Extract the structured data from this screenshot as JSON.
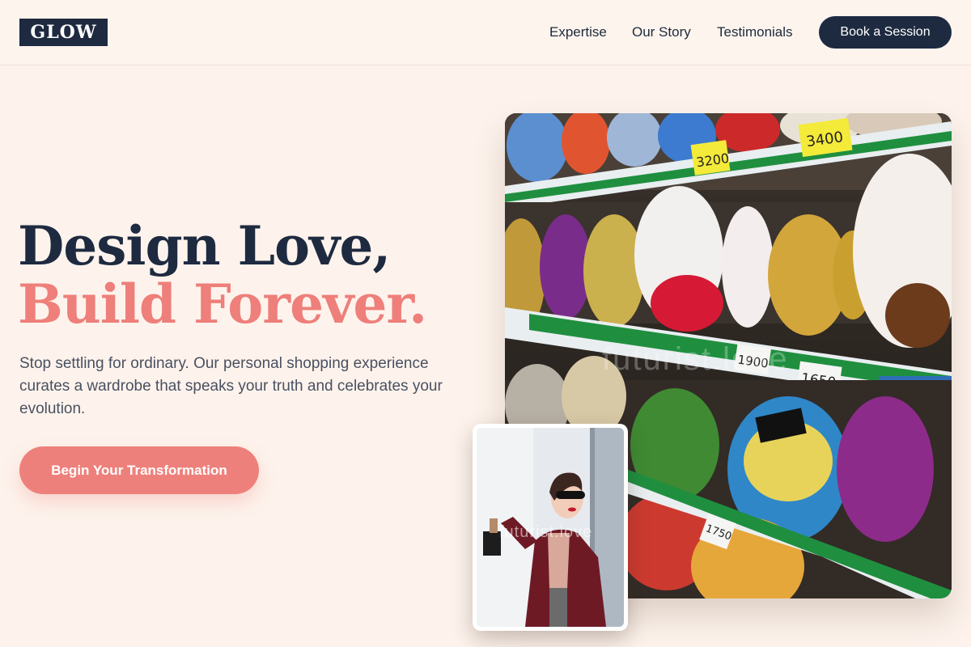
{
  "header": {
    "logo": "GLOW",
    "nav": [
      "Expertise",
      "Our Story",
      "Testimonials"
    ],
    "cta": "Book a Session"
  },
  "hero": {
    "title_line_1": "Design Love,",
    "title_line_2": "Build Forever.",
    "subtitle": "Stop settling for ordinary. Our personal shopping experience curates a wardrobe that speaks your truth and celebrates your evolution.",
    "cta": "Begin Your Transformation"
  },
  "images": {
    "main_watermark": "futurist.love",
    "inset_watermark": "futurist.love",
    "price_tags": [
      "3200",
      "3400",
      "1900",
      "1650",
      "1750"
    ]
  },
  "colors": {
    "background": "#fdf3ec",
    "navy": "#1e2a40",
    "coral": "#ee7f7a"
  }
}
